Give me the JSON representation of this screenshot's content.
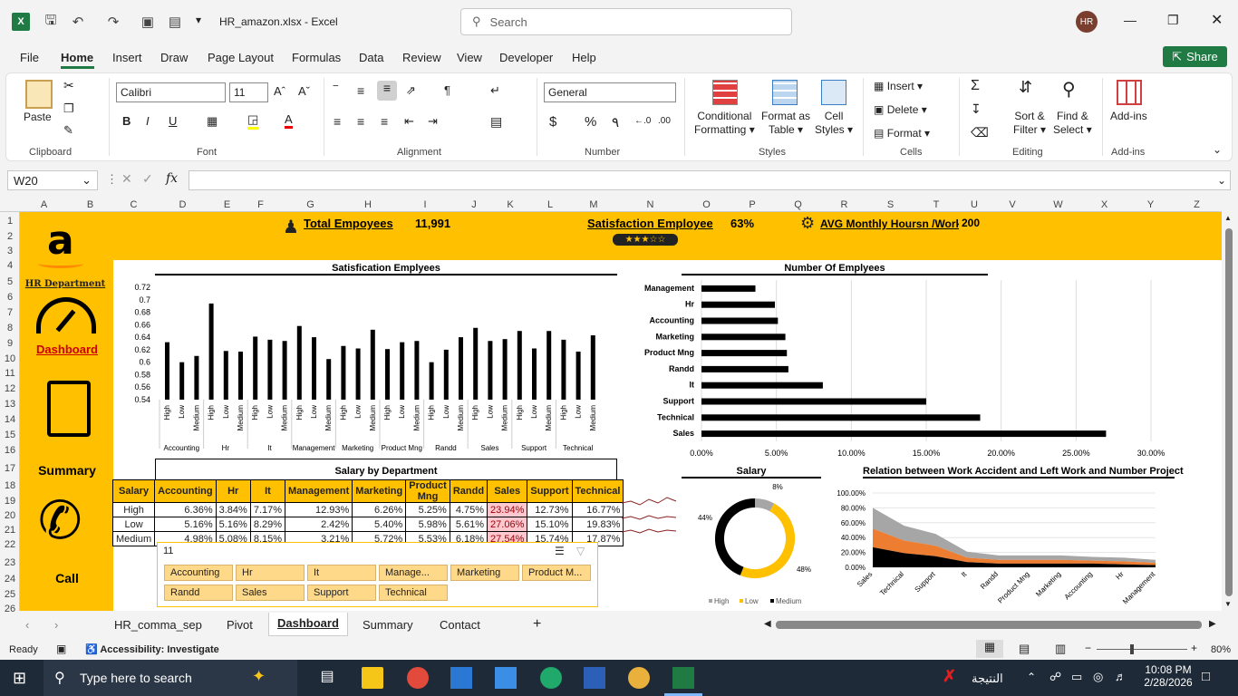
{
  "window": {
    "filename": "HR_amazon.xlsx",
    "app": "Excel",
    "search_placeholder": "Search",
    "user_initials": "HR"
  },
  "menu": [
    "File",
    "Home",
    "Insert",
    "Draw",
    "Page Layout",
    "Formulas",
    "Data",
    "Review",
    "View",
    "Developer",
    "Help"
  ],
  "share_label": "Share",
  "ribbon": {
    "paste": "Paste",
    "clipboard": "Clipboard",
    "font_name": "Calibri",
    "font_size": "11",
    "font": "Font",
    "alignment": "Alignment",
    "number_format": "General",
    "number": "Number",
    "conditional": "Conditional",
    "formatting": "Formatting",
    "format_as": "Format as",
    "table": "Table",
    "cell": "Cell",
    "styles_btn": "Styles",
    "styles": "Styles",
    "insert": "Insert",
    "delete": "Delete",
    "format": "Format",
    "cells": "Cells",
    "sort_filter_1": "Sort &",
    "sort_filter_2": "Filter",
    "find_select_1": "Find &",
    "find_select_2": "Select",
    "editing": "Editing",
    "addins_btn": "Add-ins",
    "addins": "Add-ins"
  },
  "namebox": "W20",
  "columns": [
    "A",
    "B",
    "C",
    "D",
    "E",
    "F",
    "G",
    "H",
    "I",
    "J",
    "K",
    "L",
    "M",
    "N",
    "O",
    "P",
    "Q",
    "R",
    "S",
    "T",
    "U",
    "V",
    "W",
    "X",
    "Y",
    "Z"
  ],
  "rows": [
    "1",
    "2",
    "3",
    "4",
    "5",
    "6",
    "7",
    "8",
    "9",
    "10",
    "11",
    "12",
    "13",
    "14",
    "15",
    "16",
    "17",
    "18",
    "19",
    "20",
    "21",
    "22",
    "23",
    "24",
    "25",
    "26"
  ],
  "dashboard": {
    "total_label": "Total Empoyees",
    "total_value": "11,991",
    "satisfaction_label": "Satisfaction Employee",
    "satisfaction_value": "63%",
    "rating_stars": 3,
    "avg_label": "AVG Monthly Hoursn /Work",
    "avg_value": "200",
    "side_title": "HR Department",
    "side_dashboard": "Dashboard",
    "side_summary": "Summary",
    "side_call": "Call"
  },
  "chart_data": [
    {
      "type": "bar",
      "title": "Satisfication Emplyees",
      "categories": [
        "Accounting",
        "Hr",
        "It",
        "Management",
        "Marketing",
        "Product Mng",
        "Randd",
        "Sales",
        "Support",
        "Technical"
      ],
      "subcategories": [
        "High",
        "Low",
        "Medium"
      ],
      "values": [
        [
          0.632,
          0.6,
          0.61
        ],
        [
          0.694,
          0.618,
          0.617
        ],
        [
          0.641,
          0.636,
          0.634
        ],
        [
          0.658,
          0.64,
          0.605
        ],
        [
          0.626,
          0.622,
          0.652
        ],
        [
          0.621,
          0.632,
          0.634
        ],
        [
          0.6,
          0.62,
          0.64
        ],
        [
          0.655,
          0.634,
          0.637
        ],
        [
          0.65,
          0.622,
          0.65
        ],
        [
          0.636,
          0.617,
          0.643
        ]
      ],
      "ylim": [
        0.54,
        0.72
      ],
      "yticks": [
        "0.72",
        "0.7",
        "0.68",
        "0.66",
        "0.64",
        "0.62",
        "0.6",
        "0.58",
        "0.56",
        "0.54"
      ]
    },
    {
      "type": "bar",
      "orientation": "horizontal",
      "title": "Number Of  Emplyees",
      "categories": [
        "Management",
        "Hr",
        "Accounting",
        "Marketing",
        "Product Mng",
        "Randd",
        "It",
        "Support",
        "Technical",
        "Sales"
      ],
      "values": [
        3.6,
        4.9,
        5.1,
        5.6,
        5.7,
        5.8,
        8.1,
        15.0,
        18.6,
        27.0
      ],
      "xlim": [
        0,
        30
      ],
      "xticks": [
        "0.00%",
        "5.00%",
        "10.00%",
        "15.00%",
        "20.00%",
        "25.00%",
        "30.00%"
      ]
    },
    {
      "type": "pie",
      "title": "Salary",
      "categories": [
        "High",
        "Low",
        "Medium"
      ],
      "values": [
        8,
        48,
        44
      ],
      "labels": [
        "8%",
        "48%",
        "44%"
      ],
      "colors": [
        "#a6a6a6",
        "#ffc000",
        "#000000"
      ]
    },
    {
      "type": "area",
      "title": "Relation between Work Accident and Left Work and Number Project",
      "categories": [
        "Sales",
        "Technical",
        "Support",
        "It",
        "Randd",
        "Product Mng",
        "Marketing",
        "Accounting",
        "Hr",
        "Management"
      ],
      "series": [
        {
          "values": [
            27,
            19,
            15,
            7,
            5,
            5,
            5,
            5,
            4,
            3
          ]
        },
        {
          "values": [
            25,
            17,
            14,
            6,
            5,
            5,
            5,
            4,
            4,
            3
          ]
        },
        {
          "values": [
            28,
            20,
            16,
            8,
            6,
            6,
            6,
            5,
            5,
            4
          ]
        }
      ],
      "colors": [
        "#000000",
        "#ed7d31",
        "#a6a6a6"
      ],
      "ylim": [
        0,
        100
      ],
      "yticks": [
        "100.00%",
        "80.00%",
        "60.00%",
        "40.00%",
        "20.00%",
        "0.00%"
      ]
    }
  ],
  "salary_table": {
    "title": "Salary by Department",
    "headers": [
      "Salary",
      "Accounting",
      "Hr",
      "It",
      "Management",
      "Marketing",
      "Product Mng",
      "Randd",
      "Sales",
      "Support",
      "Technical"
    ],
    "rows": [
      [
        "High",
        "6.36%",
        "3.84%",
        "7.17%",
        "12.93%",
        "6.26%",
        "5.25%",
        "4.75%",
        "23.94%",
        "12.73%",
        "16.77%"
      ],
      [
        "Low",
        "5.16%",
        "5.16%",
        "8.29%",
        "2.42%",
        "5.40%",
        "5.98%",
        "5.61%",
        "27.06%",
        "15.10%",
        "19.83%"
      ],
      [
        "Medium",
        "4.98%",
        "5.08%",
        "8.15%",
        "3.21%",
        "5.72%",
        "5.53%",
        "6.18%",
        "27.54%",
        "15.74%",
        "17.87%"
      ]
    ]
  },
  "slicer": {
    "header": "11",
    "items": [
      "Accounting",
      "Hr",
      "It",
      "Manage...",
      "Marketing",
      "Product M...",
      "Randd",
      "Sales",
      "Support",
      "Technical"
    ]
  },
  "tabs": [
    "HR_comma_sep",
    "Pivot",
    "Dashboard",
    "Summary",
    "Contact"
  ],
  "status": {
    "ready": "Ready",
    "accessibility": "Accessibility: Investigate",
    "zoom": "80%"
  },
  "taskbar": {
    "search": "Type here to search",
    "lang": "النتيجة",
    "time": "10:08 PM",
    "date": "2/28/2026"
  }
}
